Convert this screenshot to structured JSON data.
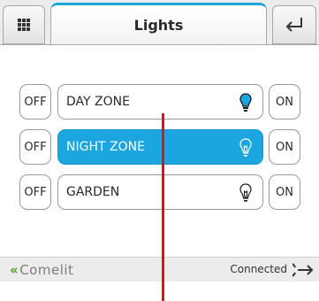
{
  "header": {
    "title": "Lights",
    "menu_icon": "grid-icon",
    "back_icon": "return-arrow-icon"
  },
  "zones": [
    {
      "name": "DAY ZONE",
      "off_label": "OFF",
      "on_label": "ON",
      "state": "on",
      "selected": false,
      "icon": "bulb-icon"
    },
    {
      "name": "NIGHT ZONE",
      "off_label": "OFF",
      "on_label": "ON",
      "state": "off",
      "selected": true,
      "icon": "bulb-icon"
    },
    {
      "name": "GARDEN",
      "off_label": "OFF",
      "on_label": "ON",
      "state": "off",
      "selected": false,
      "icon": "bulb-icon"
    }
  ],
  "statusbar": {
    "brand": "Comelit",
    "status": "Connected",
    "logout_icon": "logout-arrow-icon"
  },
  "colors": {
    "accent": "#1ca6df",
    "brand_green": "#4ba02e",
    "bulb_on": "#1ca6df",
    "pointer": "#d3152a"
  }
}
